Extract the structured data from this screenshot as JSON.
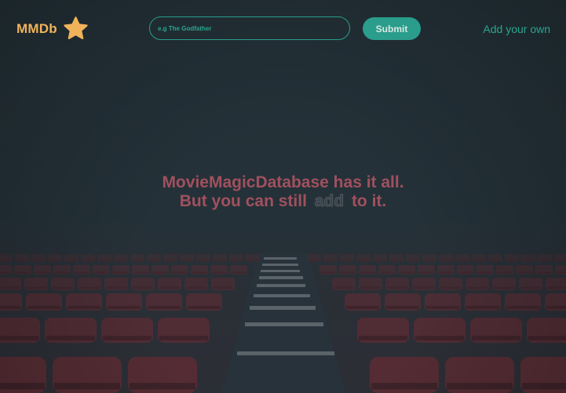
{
  "header": {
    "logo_text": "MMDb",
    "logo_icon": "star-icon",
    "search_placeholder": "e.g The Godfather",
    "submit_label": "Submit",
    "add_link_label": "Add your own"
  },
  "hero": {
    "line1": "MovieMagicDatabase has it all.",
    "line2_before": "But you can still",
    "line2_highlight": "add",
    "line2_after": "to it."
  },
  "colors": {
    "brand": "#f0b35a",
    "accent": "#2a9d8c",
    "hero_text": "#a1505f",
    "background": "#233038",
    "seat": "#5a2c34"
  },
  "background_image": "cinema-seats-with-center-stairs"
}
